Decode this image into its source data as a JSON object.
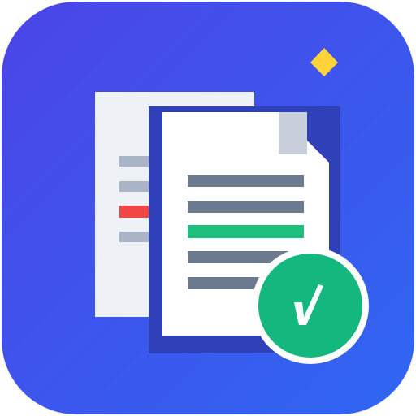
{
  "icon": {
    "name": "document-comparison-app-icon",
    "glyphs": {
      "badge": "check-icon",
      "sparkle": "diamond-sparkle-icon",
      "documents": "two-documents-icon"
    },
    "colors": {
      "background_top_left": "#4B45E6",
      "background_bottom_right": "#2F66F2",
      "back_page": "#EEF1F6",
      "front_page": "#FFFFFF",
      "page_shadow": "#3040B8",
      "folded_corner": "#C9CFDB",
      "text_line": "#6B7A8E",
      "back_text_line": "#A9B4C6",
      "removed_line": "#F04646",
      "added_line": "#1FBF7E",
      "badge_fill": "#14B87E",
      "badge_ring": "#FFFFFF",
      "sparkle": "#FFD43B"
    }
  }
}
